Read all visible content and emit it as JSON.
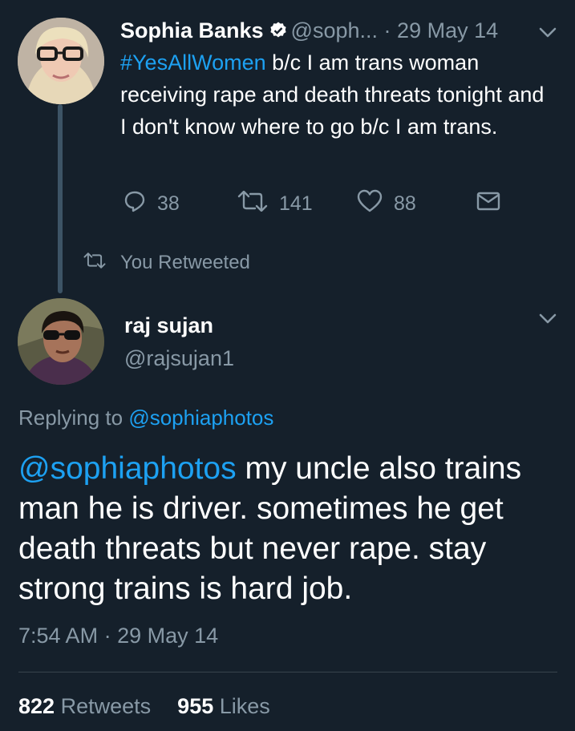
{
  "colors": {
    "background": "#15202b",
    "text_primary": "#ffffff",
    "text_secondary": "#8899a6",
    "link": "#1da1f2",
    "thread_line": "#3d5466"
  },
  "parent_tweet": {
    "author_name": "Sophia Banks",
    "verified_icon": "verified-badge-icon",
    "handle": "@soph...",
    "separator": "·",
    "date": "29 May 14",
    "hashtag": "#YesAllWomen",
    "text": " b/c I am trans woman receiving rape and death threats tonight and I don't know where to go b/c I am trans.",
    "actions": {
      "reply_icon": "reply-icon",
      "reply_count": "38",
      "retweet_icon": "retweet-icon",
      "retweet_count": "141",
      "like_icon": "heart-icon",
      "like_count": "88",
      "dm_icon": "envelope-icon"
    }
  },
  "social_context": {
    "icon": "retweet-icon",
    "label": "You Retweeted"
  },
  "main_tweet": {
    "author_name": "raj sujan",
    "handle": "@rajsujan1",
    "replying_prefix": "Replying to ",
    "replying_to": "@sophiaphotos",
    "mention": "@sophiaphotos",
    "text": " my uncle also trains man he is driver. sometimes he get death threats but never rape. stay strong trains is hard job.",
    "time": "7:54 AM",
    "separator": " · ",
    "date": "29 May 14",
    "retweets_count": "822",
    "retweets_label": "Retweets",
    "likes_count": "955",
    "likes_label": "Likes"
  }
}
